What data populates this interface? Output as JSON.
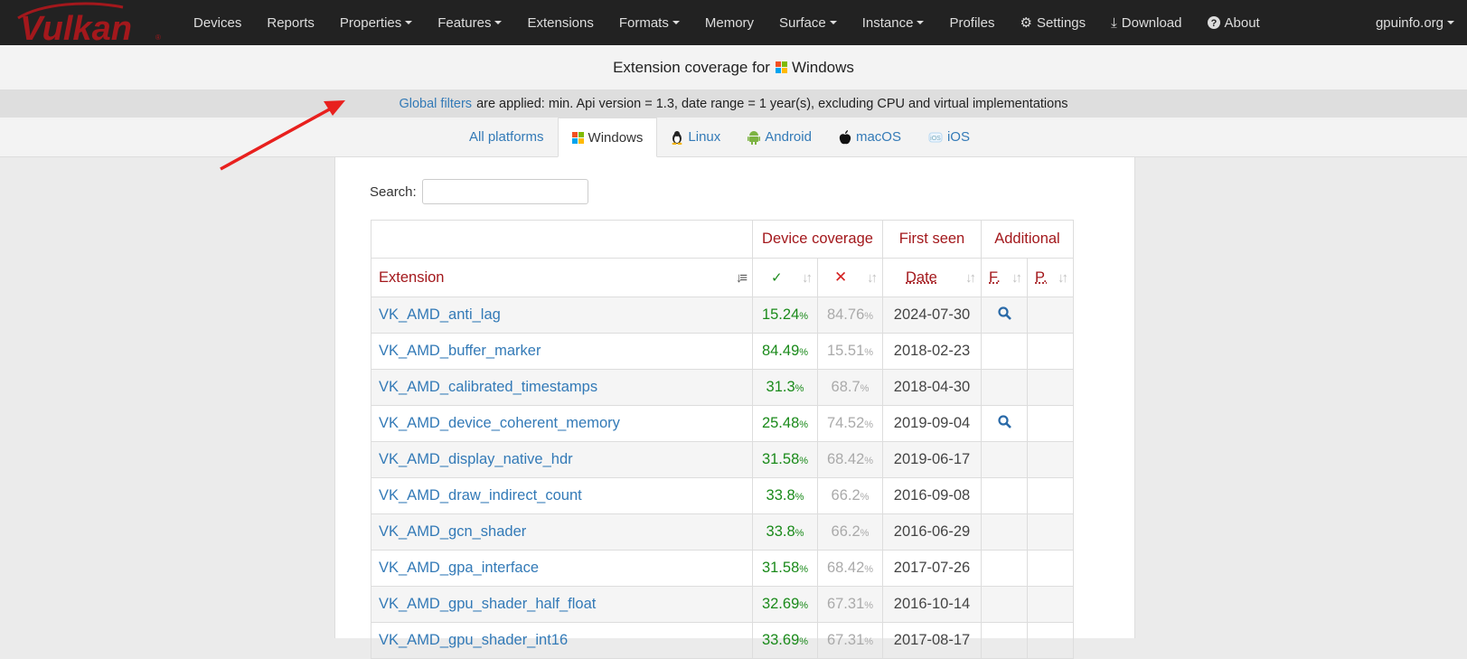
{
  "nav": {
    "brand": "Vulkan",
    "items": [
      {
        "label": "Devices",
        "dropdown": false
      },
      {
        "label": "Reports",
        "dropdown": false
      },
      {
        "label": "Properties",
        "dropdown": true
      },
      {
        "label": "Features",
        "dropdown": true
      },
      {
        "label": "Extensions",
        "dropdown": false
      },
      {
        "label": "Formats",
        "dropdown": true
      },
      {
        "label": "Memory",
        "dropdown": false
      },
      {
        "label": "Surface",
        "dropdown": true
      },
      {
        "label": "Instance",
        "dropdown": true
      },
      {
        "label": "Profiles",
        "dropdown": false
      },
      {
        "label": "Settings",
        "icon": "gear-icon"
      },
      {
        "label": "Download",
        "icon": "download-icon"
      },
      {
        "label": "About",
        "icon": "question-icon"
      }
    ],
    "right": "gpuinfo.org"
  },
  "title": {
    "prefix": "Extension coverage for",
    "platform": "Windows"
  },
  "filter": {
    "link": "Global filters",
    "text": "are applied: min. Api version = 1.3, date range = 1 year(s), excluding CPU and virtual implementations"
  },
  "tabs": [
    {
      "label": "All platforms",
      "icon": "",
      "active": false
    },
    {
      "label": "Windows",
      "icon": "windows-icon",
      "active": true
    },
    {
      "label": "Linux",
      "icon": "linux-icon",
      "active": false
    },
    {
      "label": "Android",
      "icon": "android-icon",
      "active": false
    },
    {
      "label": "macOS",
      "icon": "apple-icon",
      "active": false
    },
    {
      "label": "iOS",
      "icon": "ios-icon",
      "active": false
    }
  ],
  "search": {
    "label": "Search:",
    "value": ""
  },
  "table": {
    "group_headers": {
      "coverage": "Device coverage",
      "first_seen": "First seen",
      "additional": "Additional"
    },
    "columns": {
      "extension": "Extension",
      "date": "Date",
      "features": "F.",
      "properties": "P."
    },
    "pct_suffix": "%",
    "rows": [
      {
        "name": "VK_AMD_anti_lag",
        "supported": "15.24",
        "unsupported": "84.76",
        "date": "2024-07-30",
        "f": true
      },
      {
        "name": "VK_AMD_buffer_marker",
        "supported": "84.49",
        "unsupported": "15.51",
        "date": "2018-02-23",
        "f": false
      },
      {
        "name": "VK_AMD_calibrated_timestamps",
        "supported": "31.3",
        "unsupported": "68.7",
        "date": "2018-04-30",
        "f": false
      },
      {
        "name": "VK_AMD_device_coherent_memory",
        "supported": "25.48",
        "unsupported": "74.52",
        "date": "2019-09-04",
        "f": true
      },
      {
        "name": "VK_AMD_display_native_hdr",
        "supported": "31.58",
        "unsupported": "68.42",
        "date": "2019-06-17",
        "f": false
      },
      {
        "name": "VK_AMD_draw_indirect_count",
        "supported": "33.8",
        "unsupported": "66.2",
        "date": "2016-09-08",
        "f": false
      },
      {
        "name": "VK_AMD_gcn_shader",
        "supported": "33.8",
        "unsupported": "66.2",
        "date": "2016-06-29",
        "f": false
      },
      {
        "name": "VK_AMD_gpa_interface",
        "supported": "31.58",
        "unsupported": "68.42",
        "date": "2017-07-26",
        "f": false
      },
      {
        "name": "VK_AMD_gpu_shader_half_float",
        "supported": "32.69",
        "unsupported": "67.31",
        "date": "2016-10-14",
        "f": false
      },
      {
        "name": "VK_AMD_gpu_shader_int16",
        "supported": "33.69",
        "unsupported": "67.31",
        "date": "2017-08-17",
        "f": false
      }
    ]
  },
  "colors": {
    "navbar": "#222222",
    "link": "#337ab7",
    "header_red": "#a3181c",
    "supported_green": "#1a8a1a",
    "annotation_arrow": "#e8201e"
  }
}
